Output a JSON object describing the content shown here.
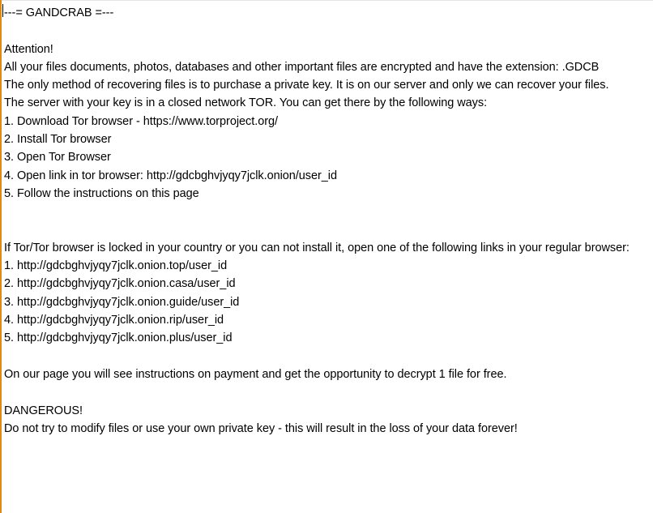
{
  "document": {
    "type": "ransom-note",
    "family": "GANDCRAB",
    "file_extension": ".GDCB",
    "onion_address": "gdcbghvjyqy7jclk.onion",
    "tor_project_url": "https://www.torproject.org/",
    "tor_link": "http://gdcbghvjyqy7jclk.onion/user_id",
    "free_decrypt_count": "1",
    "header": "---= GANDCRAB =---",
    "attention_heading": "Attention!",
    "danger_heading": "DANGEROUS!",
    "intro_lines": [
      "All your files documents, photos, databases and other important files are encrypted and have the extension: .GDCB",
      "The only method of recovering files is to purchase a private key. It is on our server and only we can recover your files.",
      "The server with your key is in a closed network TOR. You can get there by the following ways:"
    ],
    "tor_steps": [
      "1. Download Tor browser - https://www.torproject.org/",
      "2. Install Tor browser",
      "3. Open Tor Browser",
      "4. Open link in tor browser: http://gdcbghvjyqy7jclk.onion/user_id",
      "5. Follow the instructions on this page"
    ],
    "fallback_intro": "If Tor/Tor browser is locked in your country or you can not install it, open one of the following links in your regular browser:",
    "mirror_links": [
      "1. http://gdcbghvjyqy7jclk.onion.top/user_id",
      "2. http://gdcbghvjyqy7jclk.onion.casa/user_id",
      "3. http://gdcbghvjyqy7jclk.onion.guide/user_id",
      "4. http://gdcbghvjyqy7jclk.onion.rip/user_id",
      "5. http://gdcbghvjyqy7jclk.onion.plus/user_id"
    ],
    "payment_line": "On our page you will see instructions on payment and get the opportunity to decrypt 1 file for free.",
    "warning_line": "Do not try to modify files or use your own private key - this will result in the loss of your data forever!"
  },
  "colors": {
    "text": "#000000",
    "background": "#ffffff",
    "left_accent": "#e08a14",
    "top_rule": "#e4e4e4"
  }
}
